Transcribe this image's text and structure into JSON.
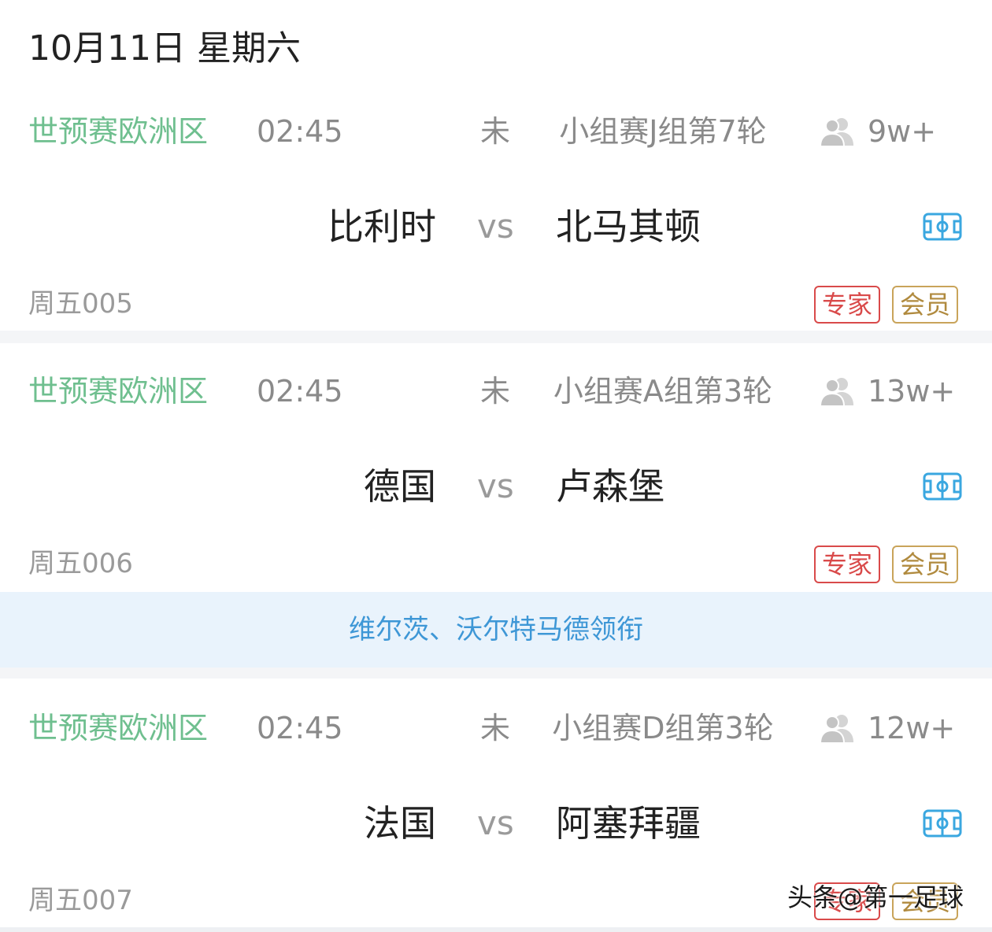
{
  "date_header": "10月11日 星期六",
  "matches": [
    {
      "league": "世预赛欧洲区",
      "time": "02:45",
      "status": "未",
      "round": "小组赛J组第7轮",
      "count": "9w+",
      "home": "比利时",
      "vs": "vs",
      "away": "北马其顿",
      "code": "周五005",
      "badge_expert": "专家",
      "badge_member": "会员"
    },
    {
      "league": "世预赛欧洲区",
      "time": "02:45",
      "status": "未",
      "round": "小组赛A组第3轮",
      "count": "13w+",
      "home": "德国",
      "vs": "vs",
      "away": "卢森堡",
      "code": "周五006",
      "badge_expert": "专家",
      "badge_member": "会员"
    },
    {
      "league": "世预赛欧洲区",
      "time": "02:45",
      "status": "未",
      "round": "小组赛D组第3轮",
      "count": "12w+",
      "home": "法国",
      "vs": "vs",
      "away": "阿塞拜疆",
      "code": "周五007",
      "badge_expert": "专家",
      "badge_member": "会员"
    }
  ],
  "news_banner": "维尔茨、沃尔特马德领衔",
  "watermark": "头条@第一足球",
  "icons": {
    "people": "people-icon",
    "field": "football-field-icon"
  },
  "colors": {
    "league_green": "#6fbf8f",
    "expert_red": "#d94a4a",
    "member_gold": "#c9a45a",
    "field_icon_blue": "#3aa7e0",
    "banner_bg": "#e9f3fc",
    "banner_text": "#3e97d6"
  }
}
